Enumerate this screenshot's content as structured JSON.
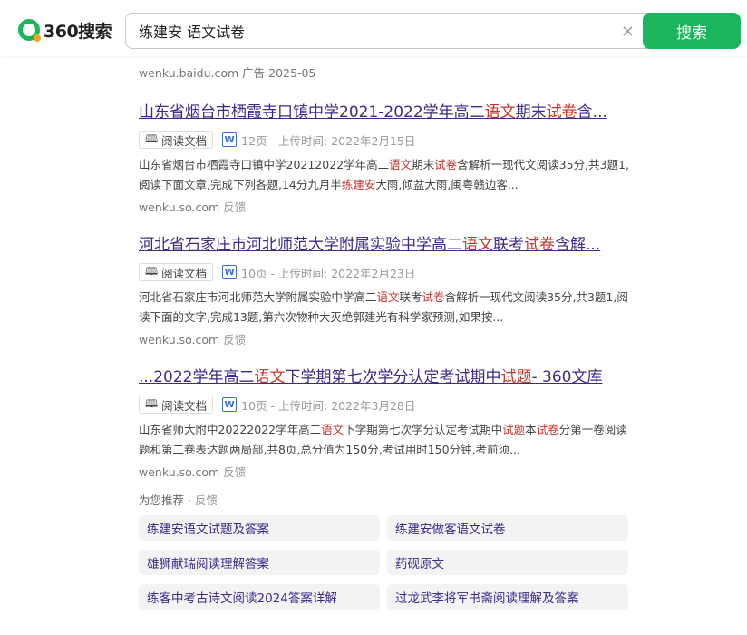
{
  "header": {
    "logo_text": "360搜索",
    "search_value": "练建安 语文试卷",
    "clear_label": "×",
    "search_button": "搜索"
  },
  "ad_line": "wenku.baidu.com 广告 2025-05",
  "results": [
    {
      "title_parts": [
        "山东省烟台市栖霞寺口镇中学2021-2022学年高二",
        "语文",
        "期末",
        "试卷",
        "含..."
      ],
      "read_label": "阅读文档",
      "meta": "12页 - 上传时间: 2022年2月15日",
      "desc_parts": [
        "山东省烟台市栖霞寺口镇中学20212022学年高二",
        "语文",
        "期末",
        "试卷",
        "含解析一现代文阅读35分,共3题1,阅读下面文章,完成下列各题,14分九月半",
        "练建安",
        "大雨,倾盆大雨,闽粤赣边客..."
      ],
      "source": "wenku.so.com",
      "feedback": "反馈"
    },
    {
      "title_parts": [
        "河北省石家庄市河北师范大学附属实验中学高二",
        "语文",
        "联考",
        "试卷",
        "含解..."
      ],
      "read_label": "阅读文档",
      "meta": "10页 - 上传时间: 2022年2月23日",
      "desc_parts": [
        "河北省石家庄市河北师范大学附属实验中学高二",
        "语文",
        "联考",
        "试卷",
        "含解析一现代文阅读35分,共3题1,阅读下面的文字,完成13题,第六次物种大灭绝郭建光有科学家预测,如果按..."
      ],
      "source": "wenku.so.com",
      "feedback": "反馈"
    },
    {
      "title_parts": [
        "...2022学年高二",
        "语文",
        "下学期第七次学分认定考试期中",
        "试题",
        "- 360文库"
      ],
      "read_label": "阅读文档",
      "meta": "10页 - 上传时间: 2022年3月28日",
      "desc_parts": [
        "山东省师大附中20222022学年高二",
        "语文",
        "下学期第七次学分认定考试期中",
        "试题",
        "本",
        "试卷",
        "分第一卷阅读题和第二卷表达题两局部,共8页,总分值为150分,考试用时150分钟,考前须..."
      ],
      "source": "wenku.so.com",
      "feedback": "反馈"
    }
  ],
  "recommend": {
    "title": "为您推荐",
    "feedback": "· 反馈",
    "items": [
      "练建安语文试题及答案",
      "练建安做客语文试卷",
      "雄狮献瑞阅读理解答案",
      "药砚原文",
      "练客中考古诗文阅读2024答案详解",
      "过龙武李将军书斋阅读理解及答案"
    ]
  }
}
